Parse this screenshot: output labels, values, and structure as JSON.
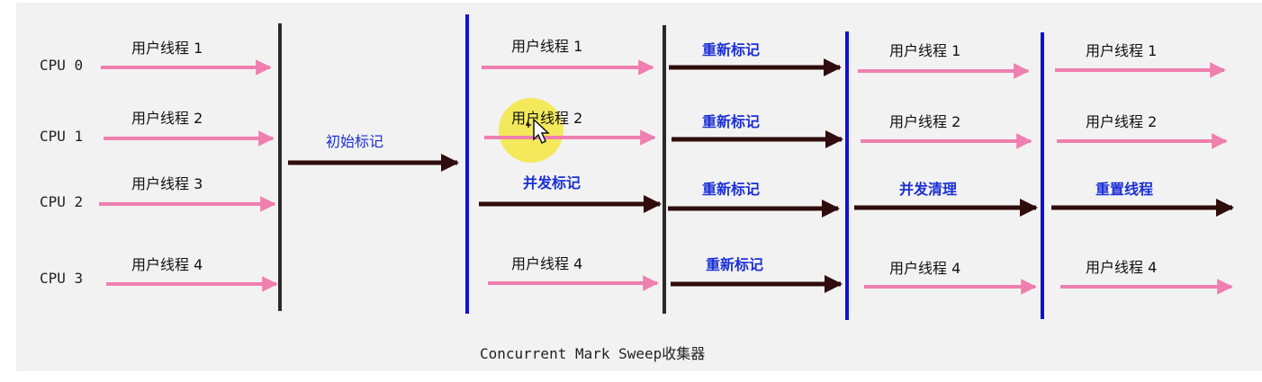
{
  "caption": "Concurrent Mark Sweep收集器",
  "cpu_labels": [
    "CPU 0",
    "CPU 1",
    "CPU 2",
    "CPU 3"
  ],
  "thread_labels": [
    "用户线程 1",
    "用户线程 2",
    "用户线程 3",
    "用户线程 4"
  ],
  "phases": {
    "initial_mark": "初始标记",
    "concurrent_mark": "并发标记",
    "remark": "重新标记",
    "concurrent_sweep": "并发清理",
    "reset_threads": "重置线程"
  },
  "colors": {
    "user_thread_arrow": "#ef7fae",
    "gc_arrow": "#300c0c",
    "gc_label": "#1a2fd6",
    "thread_label": "#111111",
    "barrier_dark": "#2a2a2a",
    "barrier_blue": "#1010dd",
    "background": "#f2f2f2",
    "cursor_highlight": "#f3e84a"
  },
  "icons": {
    "cursor": "mouse-cursor-icon"
  }
}
